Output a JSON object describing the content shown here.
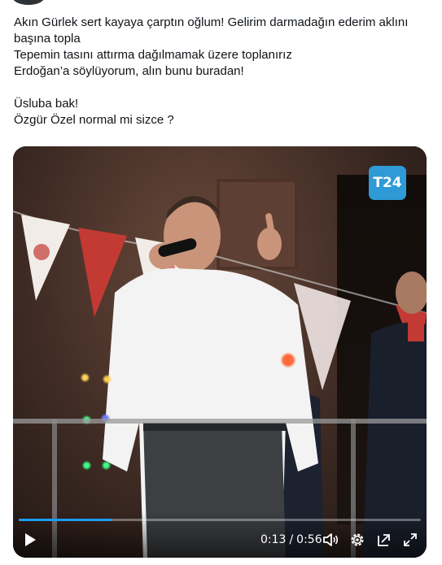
{
  "tweet": {
    "lines": [
      "Akın Gürlek sert kayaya çarptın oğlum! Gelirim darmadağın ederim aklını",
      "başına topla",
      "Tepemin tasını attırma dağılmamak üzere toplanırız",
      "Erdoğan’a söylüyorum, alın bunu buradan!",
      "",
      "Üsluba bak!",
      "Özgür Özel normal mi sizce ?"
    ]
  },
  "video": {
    "logo_text": "T24",
    "logo_color": "#2e9ad6",
    "current_time": "0:13",
    "separator": "/",
    "duration": "0:56",
    "progress_fraction": 0.232,
    "progress_color": "#1d9bf0",
    "icons": [
      "play-icon",
      "volume-icon",
      "settings-icon",
      "pop-out-icon",
      "fullscreen-icon"
    ]
  }
}
